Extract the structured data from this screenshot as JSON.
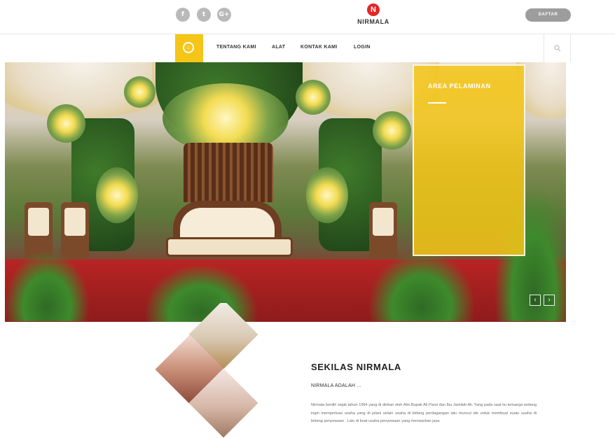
{
  "header": {
    "social": [
      {
        "name": "facebook-icon",
        "glyph": "f"
      },
      {
        "name": "twitter-icon",
        "glyph": "t"
      },
      {
        "name": "google-plus-icon",
        "glyph": "G+"
      }
    ],
    "logo_mark": "N",
    "logo_text": "NIRMALA",
    "register_label": "DAFTAR"
  },
  "nav": {
    "home_icon": "home-icon",
    "items": [
      "TENTANG KAMI",
      "ALAT",
      "KONTAK KAMI",
      "LOGIN"
    ],
    "search_icon": "⌕"
  },
  "hero": {
    "caption_title": "AREA PELAMINAN",
    "prev_arrow": "‹",
    "next_arrow": "›"
  },
  "about": {
    "title": "SEKILAS NIRMALA",
    "subtitle": "NIRMALA ADALAH ...",
    "body": "Nirmala berdiri sejak tahun 1994 yang di dirikan oleh Alm.Bapak Ali Parai dan Ibu Jamilah Ali. Yang pada saat itu keluarga sedang ingin memperluas usaha yang di jalani selain usaha di bidang perdagangan lalu muncul ide untuk membuat suatu usaha di bidang penyewaan . Lalu di buat usaha penyewaan yang menwarkan jasa"
  },
  "colors": {
    "accent": "#f5c518",
    "logo_red": "#e32626",
    "button_gray": "#9d9d9d"
  }
}
